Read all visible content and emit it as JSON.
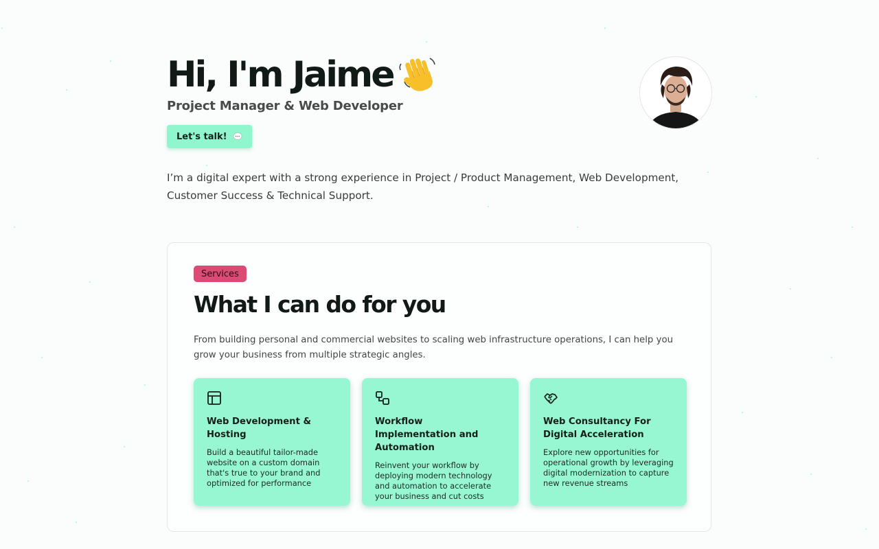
{
  "hero": {
    "title": "Hi, I'm Jaime",
    "subtitle": "Project Manager & Web Developer",
    "cta_label": "Let's talk!",
    "intro": "I’m a digital expert with a strong experience in Project / Product Management, Web Development, Customer Success & Technical Support."
  },
  "services": {
    "badge": "Services",
    "title": "What I can do for you",
    "description": "From building personal and commercial websites to scaling web infrastructure operations, I can help you grow your business from multiple strategic angles.",
    "items": [
      {
        "icon": "layout-icon",
        "title": "Web Development & Hosting",
        "text": "Build a beautiful tailor-made website on a custom domain that's true to your brand and optimized for performance"
      },
      {
        "icon": "workflow-icon",
        "title": "Workflow Implementation and Automation",
        "text": "Reinvent your workflow by deploying modern technology and automation to accelerate your business and cut costs"
      },
      {
        "icon": "handshake-icon",
        "title": "Web Consultancy For Digital Acceleration",
        "text": "Explore new opportunities for operational growth by leveraging digital modernization to capture new revenue streams"
      }
    ]
  },
  "colors": {
    "accent_mint": "#97f7d2",
    "badge_pink": "#da4c73",
    "heading": "#121a16"
  }
}
